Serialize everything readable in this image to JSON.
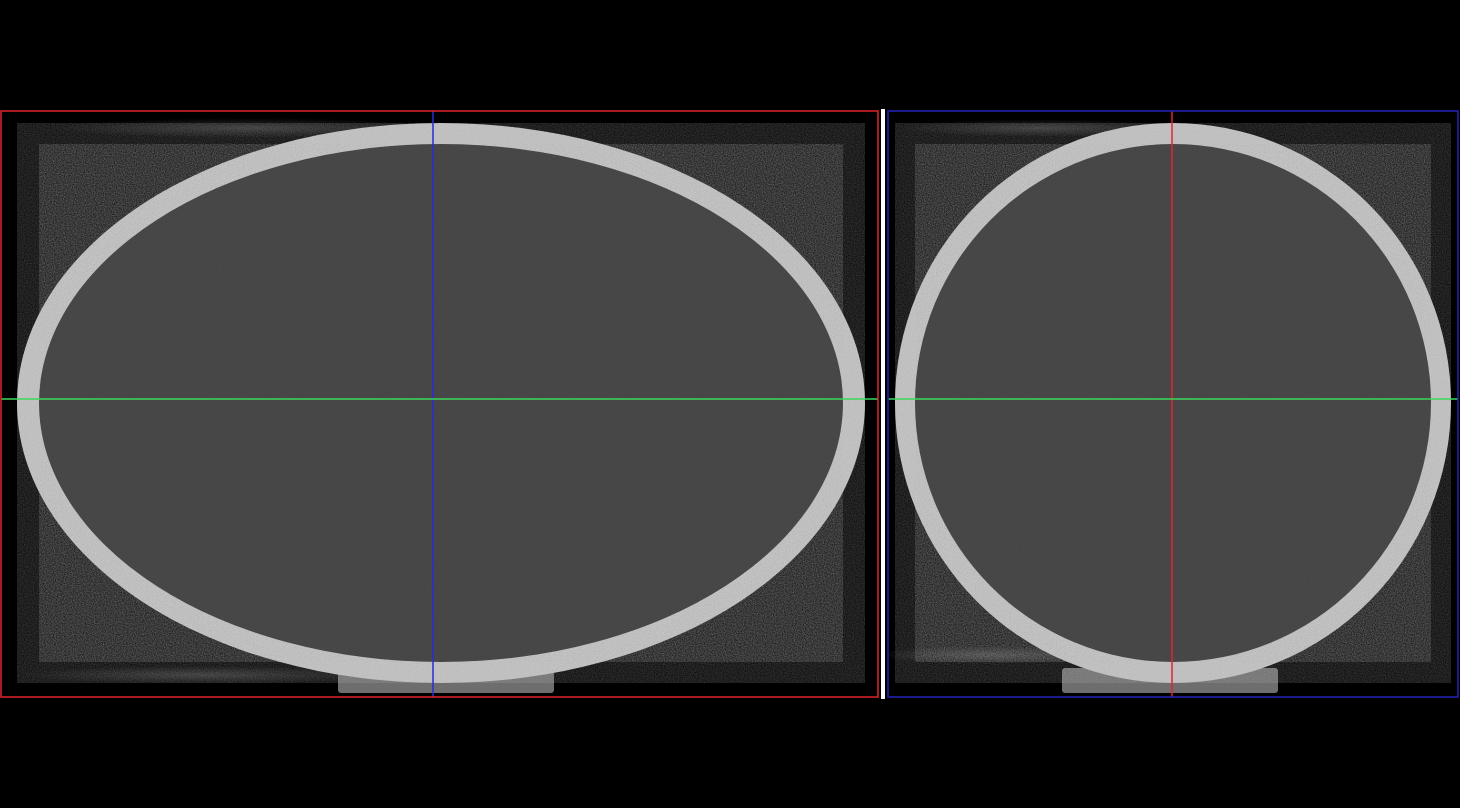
{
  "viewer": {
    "background_color": "#000000",
    "views": [
      {
        "id": "view-left",
        "frame_color": "#e0262a",
        "vertical_crosshair_color": "#2a2ad8",
        "horizontal_crosshair_color": "#3cd85a",
        "shell_color": "#c8c8c8",
        "interior_color": "#4a4a4a"
      },
      {
        "id": "view-right",
        "frame_color": "#2323b8",
        "vertical_crosshair_color": "#e0262a",
        "horizontal_crosshair_color": "#3cd85a",
        "shell_color": "#c8c8c8",
        "interior_color": "#4a4a4a"
      }
    ],
    "divider_color": "#ffffff"
  }
}
